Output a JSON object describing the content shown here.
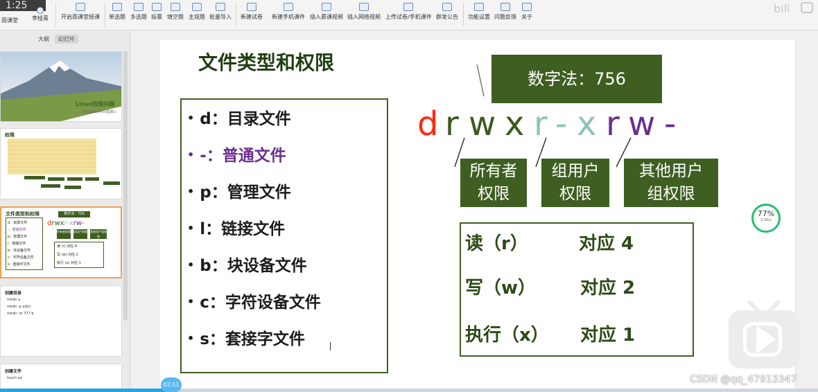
{
  "ribbon": {
    "time": "1:25",
    "user_left": "雨课堂",
    "user_name": "李桂青",
    "items": [
      {
        "label": "开启雨课堂授课",
        "icon": "play-icon"
      },
      {
        "label": "单选题",
        "icon": "single-choice-icon"
      },
      {
        "label": "多选题",
        "icon": "multi-choice-icon"
      },
      {
        "label": "投票",
        "icon": "vote-icon"
      },
      {
        "label": "填空题",
        "icon": "fill-blank-icon"
      },
      {
        "label": "主观题",
        "icon": "subjective-icon"
      },
      {
        "label": "批量导入",
        "icon": "import-icon"
      },
      {
        "label": "新建试卷",
        "icon": "new-paper-icon"
      },
      {
        "label": "新建手机课件",
        "icon": "mobile-courseware-icon"
      },
      {
        "label": "插入慕课视频",
        "icon": "mooc-video-icon"
      },
      {
        "label": "插入网络视频",
        "icon": "web-video-icon"
      },
      {
        "label": "上传试卷/手机课件",
        "icon": "upload-icon"
      },
      {
        "label": "群发公告",
        "icon": "announce-icon"
      },
      {
        "label": "功能设置",
        "icon": "settings-icon"
      },
      {
        "label": "问题反馈",
        "icon": "feedback-icon"
      },
      {
        "label": "关于",
        "icon": "about-icon"
      }
    ]
  },
  "panel": {
    "tab_outline": "大纲",
    "tab_slides": "幻灯片"
  },
  "thumbs": {
    "t1": {
      "title": "Linux权限问题",
      "date": "2022年9月4日星期三"
    },
    "t2": {
      "title": "权限"
    },
    "t3": {
      "title": "文件类型和权限",
      "num": "数字法：756",
      "list": [
        "d：目录文件",
        "-：普通文件",
        "p：管理文件",
        "l：链接文件",
        "b：块设备文件",
        "c：字符设备文件",
        "s：套接字文件"
      ],
      "groups": [
        "所有者权限",
        "组用户权限",
        "其他用户组权限"
      ],
      "rows": [
        "读 (r)    对应 4",
        "写 (w)    对应 2",
        "执行 (x)  对应 1"
      ]
    },
    "t4": {
      "title": "创建目录",
      "lines": [
        "mkdir a",
        "mkdir -p a/b/c",
        "mkdir -m 777 b"
      ]
    },
    "t5": {
      "title": "创建文件",
      "lines": [
        "touch aa"
      ]
    }
  },
  "slide": {
    "title": "文件类型和权限",
    "number_method": "数字法：756",
    "file_types": [
      {
        "bullet": "•",
        "text": "d：目录文件"
      },
      {
        "bullet": "•",
        "text": "-：普通文件"
      },
      {
        "bullet": "•",
        "text": "p：管理文件"
      },
      {
        "bullet": "•",
        "text": "l：链接文件"
      },
      {
        "bullet": "•",
        "text": "b：块设备文件"
      },
      {
        "bullet": "•",
        "text": "c：字符设备文件"
      },
      {
        "bullet": "•",
        "text": "s：套接字文件"
      }
    ],
    "perm_chars": [
      "d",
      "r",
      "w",
      "x",
      "r",
      "-",
      "x",
      "r",
      "w",
      "-"
    ],
    "groups": [
      {
        "line1": "所有者",
        "line2": "权限"
      },
      {
        "line1": "组用户",
        "line2": "权限"
      },
      {
        "line1": "其他用户",
        "line2": "组权限"
      }
    ],
    "table": [
      {
        "perm": "读（r）",
        "value": "对应 4"
      },
      {
        "perm": "写（w）",
        "value": "对应 2"
      },
      {
        "perm": "执行（x）",
        "value": "对应 1"
      }
    ]
  },
  "overlay": {
    "speed_percent": "77%",
    "speed_rate": "0.5K/s",
    "progress_time": "02:11",
    "watermark": "CSDN @qq_47913347",
    "progress_fraction": 0.21
  },
  "colors": {
    "dark_green": "#3f5e22",
    "title_green": "#1f3d10",
    "red": "#ff2a10",
    "teal": "#8ec3b8",
    "purple": "#6a2f8c",
    "progress_blue": "#23a5e6"
  }
}
